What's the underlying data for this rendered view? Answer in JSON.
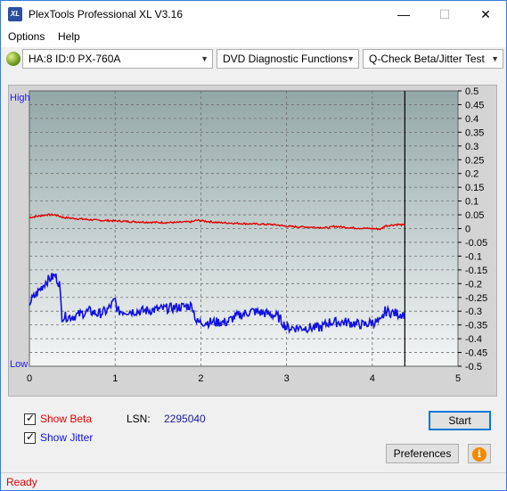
{
  "window": {
    "title": "PlexTools Professional XL V3.16",
    "app_icon_text": "XL",
    "minimize": "—",
    "maximize": "☐",
    "close": "✕"
  },
  "menu": {
    "options": "Options",
    "help": "Help"
  },
  "toolbar": {
    "drive": "HA:8 ID:0  PX-760A",
    "function": "DVD Diagnostic Functions",
    "test": "Q-Check Beta/Jitter Test"
  },
  "chart_data": {
    "type": "line",
    "ylabel_high": "High",
    "ylabel_low": "Low",
    "xlim": [
      0,
      5
    ],
    "ylim": [
      -0.5,
      0.5
    ],
    "x_ticks": [
      "0",
      "1",
      "2",
      "3",
      "4",
      "5"
    ],
    "y_ticks": [
      "0.5",
      "0.45",
      "0.4",
      "0.35",
      "0.3",
      "0.25",
      "0.2",
      "0.15",
      "0.1",
      "0.05",
      "0",
      "-0.05",
      "-0.1",
      "-0.15",
      "-0.2",
      "-0.25",
      "-0.3",
      "-0.35",
      "-0.4",
      "-0.45",
      "-0.5"
    ],
    "end_marker_x": 4.38,
    "grid": true,
    "series": [
      {
        "name": "Beta",
        "color": "#e00000",
        "x": [
          0,
          0.1,
          0.2,
          0.3,
          0.35,
          0.4,
          0.6,
          0.8,
          1.0,
          1.2,
          1.5,
          1.7,
          1.9,
          1.95,
          2.2,
          2.5,
          2.8,
          2.9,
          3.0,
          3.3,
          3.5,
          3.55,
          3.8,
          4.0,
          4.1,
          4.15,
          4.3,
          4.38
        ],
        "y": [
          0.04,
          0.045,
          0.05,
          0.05,
          0.045,
          0.04,
          0.035,
          0.03,
          0.028,
          0.025,
          0.022,
          0.022,
          0.025,
          0.03,
          0.022,
          0.018,
          0.015,
          0.013,
          0.008,
          0.005,
          0.003,
          0.008,
          0.002,
          0.0,
          -0.002,
          0.01,
          0.015,
          0.012
        ]
      },
      {
        "name": "Jitter",
        "color": "#1010e0",
        "x": [
          0,
          0.1,
          0.2,
          0.3,
          0.35,
          0.38,
          0.5,
          0.7,
          0.8,
          0.9,
          1.0,
          1.03,
          1.1,
          1.3,
          1.6,
          1.9,
          1.95,
          2.1,
          2.3,
          2.4,
          2.6,
          2.8,
          2.9,
          3.0,
          3.2,
          3.4,
          3.5,
          3.7,
          3.9,
          4.0,
          4.1,
          4.15,
          4.3,
          4.38
        ],
        "y": [
          -0.27,
          -0.23,
          -0.19,
          -0.17,
          -0.2,
          -0.32,
          -0.32,
          -0.3,
          -0.31,
          -0.3,
          -0.26,
          -0.3,
          -0.3,
          -0.3,
          -0.29,
          -0.28,
          -0.34,
          -0.34,
          -0.34,
          -0.32,
          -0.3,
          -0.31,
          -0.32,
          -0.36,
          -0.36,
          -0.36,
          -0.34,
          -0.34,
          -0.35,
          -0.34,
          -0.34,
          -0.3,
          -0.31,
          -0.31
        ]
      }
    ]
  },
  "controls": {
    "show_beta": "Show Beta",
    "show_jitter": "Show Jitter",
    "lsn_label": "LSN:",
    "lsn_value": "2295040",
    "start": "Start",
    "preferences": "Preferences",
    "info_icon": "i"
  },
  "status": {
    "text": "Ready"
  },
  "colors": {
    "accent": "#0078d7",
    "beta": "#e00000",
    "jitter": "#1010e0",
    "plot_top": "#95a8a8",
    "plot_bottom": "#f2f5f5"
  }
}
